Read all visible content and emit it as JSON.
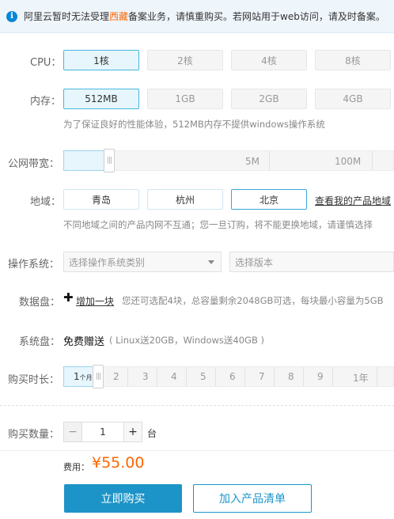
{
  "notice": {
    "before": "阿里云暂时无法受理",
    "highlight": "西藏",
    "after": "备案业务，请慎重购买。若网站用于web访问，请及时备案。"
  },
  "cpu": {
    "label": "CPU：",
    "options": [
      "1核",
      "2核",
      "4核",
      "8核"
    ],
    "selected": "1核"
  },
  "memory": {
    "label": "内存：",
    "options": [
      "512MB",
      "1GB",
      "2GB",
      "4GB"
    ],
    "selected": "512MB",
    "hint": "为了保证良好的性能体验，512MB内存不提供windows操作系统"
  },
  "bandwidth": {
    "label": "公网带宽：",
    "ticks": [
      "5M",
      "100M"
    ]
  },
  "region": {
    "label": "地域：",
    "options": [
      "青岛",
      "杭州",
      "北京"
    ],
    "selected": "北京",
    "link": "查看我的产品地域",
    "hint": "不同地域之间的产品内网不互通；您一旦订购，将不能更换地域，请谨慎选择"
  },
  "os": {
    "label": "操作系统：",
    "category_placeholder": "选择操作系统类别",
    "version_placeholder": "选择版本"
  },
  "data_disk": {
    "label": "数据盘：",
    "add_label": "增加一块",
    "hint": "您还可选配4块，总容量剩余2048GB可选，每块最小容量为5GB"
  },
  "system_disk": {
    "label": "系统盘：",
    "value": "免费赠送",
    "note": "( Linux送20GB，Windows送40GB )"
  },
  "duration": {
    "label": "购买时长：",
    "selected_num": "1",
    "selected_unit": "个月",
    "ticks": [
      "2",
      "3",
      "4",
      "5",
      "6",
      "7",
      "8",
      "9",
      "1年"
    ]
  },
  "quantity": {
    "label": "购买数量：",
    "minus": "−",
    "value": "1",
    "plus": "+",
    "unit": "台"
  },
  "footer": {
    "fee_label": "费用：",
    "price": "¥55.00",
    "buy_label": "立即购买",
    "cart_label": "加入产品清单"
  }
}
